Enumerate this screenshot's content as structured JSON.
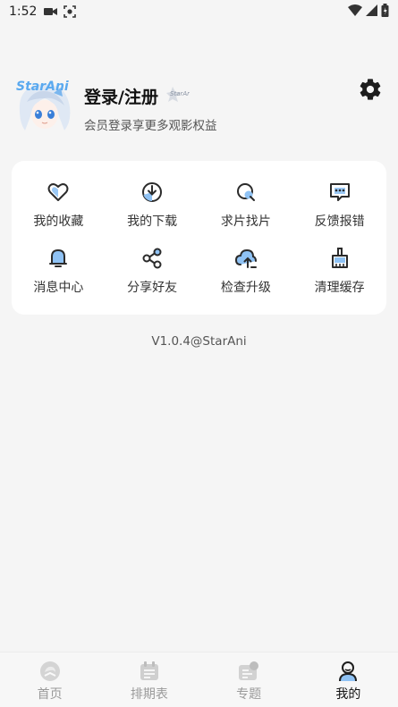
{
  "status_bar": {
    "time": "1:52",
    "icons": [
      "video-camera-icon",
      "screenshot-icon",
      "wifi-icon",
      "signal-icon",
      "battery-icon"
    ]
  },
  "profile": {
    "title": "登录/注册",
    "subtitle": "会员登录享更多观影权益",
    "avatar_logo_text": "StarAni",
    "settings_icon": "gear-icon"
  },
  "menu": {
    "items": [
      {
        "label": "我的收藏",
        "icon": "heart-icon"
      },
      {
        "label": "我的下载",
        "icon": "download-icon"
      },
      {
        "label": "求片找片",
        "icon": "search-film-icon"
      },
      {
        "label": "反馈报错",
        "icon": "feedback-icon"
      },
      {
        "label": "消息中心",
        "icon": "bell-icon"
      },
      {
        "label": "分享好友",
        "icon": "share-icon"
      },
      {
        "label": "检查升级",
        "icon": "cloud-upload-icon"
      },
      {
        "label": "清理缓存",
        "icon": "broom-icon"
      }
    ]
  },
  "version": "V1.0.4@StarAni",
  "bottom_nav": {
    "items": [
      {
        "label": "首页",
        "icon": "home-icon",
        "active": false
      },
      {
        "label": "排期表",
        "icon": "calendar-icon",
        "active": false
      },
      {
        "label": "专题",
        "icon": "topic-icon",
        "active": false
      },
      {
        "label": "我的",
        "icon": "profile-icon",
        "active": true
      }
    ]
  },
  "colors": {
    "accent": "#8fc2f4",
    "icon_stroke": "#2b2b2b",
    "background": "#f5f5f5",
    "card": "#ffffff"
  }
}
